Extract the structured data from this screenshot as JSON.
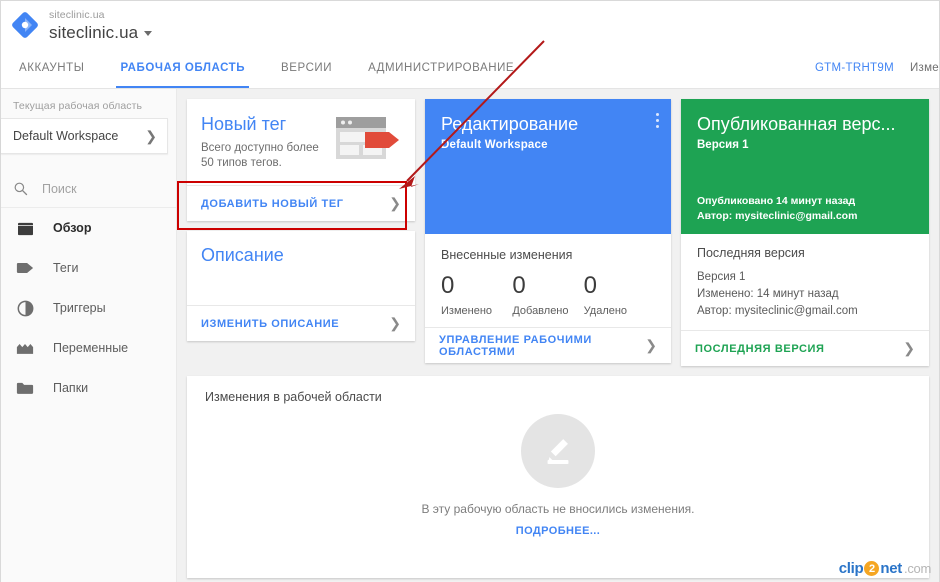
{
  "header": {
    "account_sub": "siteclinic.ua",
    "account_name": "siteclinic.ua",
    "logo_icon": "gtm-diamond-logo",
    "caret_icon": "chevron-down-icon"
  },
  "tabs": [
    {
      "label": "АККАУНТЫ",
      "active": false
    },
    {
      "label": "РАБОЧАЯ ОБЛАСТЬ",
      "active": true
    },
    {
      "label": "ВЕРСИИ",
      "active": false
    },
    {
      "label": "АДМИНИСТРИРОВАНИЕ",
      "active": false
    }
  ],
  "header_right": {
    "container_id": "GTM-TRHT9M",
    "edit_link": "Изме"
  },
  "sidebar": {
    "workspace_label": "Текущая рабочая область",
    "workspace_value": "Default Workspace",
    "workspace_chevron": "chevron-right-icon",
    "search_placeholder": "Поиск",
    "search_icon": "search-icon",
    "items": [
      {
        "label": "Обзор",
        "icon": "overview-icon",
        "selected": true
      },
      {
        "label": "Теги",
        "icon": "tag-icon",
        "selected": false
      },
      {
        "label": "Триггеры",
        "icon": "trigger-icon",
        "selected": false
      },
      {
        "label": "Переменные",
        "icon": "variables-icon",
        "selected": false
      },
      {
        "label": "Папки",
        "icon": "folder-icon",
        "selected": false
      }
    ]
  },
  "cards": {
    "new_tag": {
      "title": "Новый тег",
      "subtitle_line1": "Всего доступно более",
      "subtitle_line2": "50 типов тегов.",
      "illustration_icon": "browser-tag-illustration",
      "action_label": "ДОБАВИТЬ НОВЫЙ ТЕГ",
      "action_chevron": "chevron-right-icon"
    },
    "description": {
      "title": "Описание",
      "action_label": "ИЗМЕНИТЬ ОПИСАНИЕ",
      "action_chevron": "chevron-right-icon"
    },
    "editing": {
      "title": "Редактирование",
      "workspace": "Default Workspace",
      "menu_icon": "kebab-menu-icon",
      "stats_heading": "Внесенные изменения",
      "stats": [
        {
          "value": "0",
          "label": "Изменено"
        },
        {
          "value": "0",
          "label": "Добавлено"
        },
        {
          "value": "0",
          "label": "Удалено"
        }
      ],
      "action_label": "УПРАВЛЕНИЕ РАБОЧИМИ ОБЛАСТЯМИ",
      "action_chevron": "chevron-right-icon"
    },
    "published": {
      "title": "Опубликованная верс...",
      "version": "Версия 1",
      "published_at": "Опубликовано 14 минут назад",
      "published_author": "Автор: mysiteclinic@gmail.com",
      "latest_heading": "Последняя версия",
      "latest_version": "Версия 1",
      "latest_modified": "Изменено: 14 минут назад",
      "latest_author": "Автор: mysiteclinic@gmail.com",
      "action_label": "ПОСЛЕДНЯЯ ВЕРСИЯ",
      "action_chevron": "chevron-right-icon"
    }
  },
  "changes_panel": {
    "heading": "Изменения в рабочей области",
    "empty_icon": "pencil-edit-icon",
    "empty_text": "В эту рабочую область не вносились изменения.",
    "more_link": "ПОДРОБНЕЕ..."
  },
  "watermark": {
    "part1": "clip",
    "digit": "2",
    "part2": "net",
    "part3": ".com"
  },
  "colors": {
    "brand_blue": "#4285f4",
    "card_blue": "#4285f4",
    "card_green": "#1ea353",
    "annotation_red": "#cc0000",
    "tag_red": "#e14b3a"
  }
}
